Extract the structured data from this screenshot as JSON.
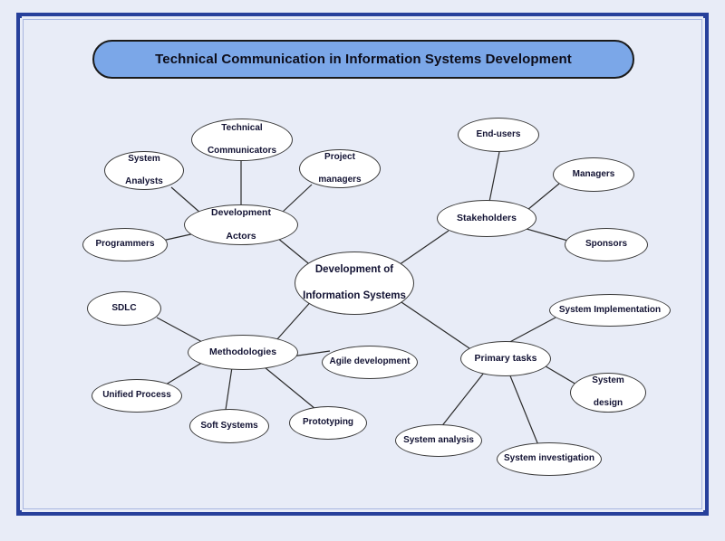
{
  "document": {
    "title": "Technical Communication in Information Systems Development",
    "background_color": "#e8ecf7",
    "frame_color": "#27409b",
    "title_fill_color": "#7ba7e8",
    "node_fill_color": "#ffffff",
    "node_text_color": "#121233"
  },
  "chart_data": {
    "type": "diagram",
    "diagram_kind": "mind-map",
    "title": "Technical Communication in Information Systems Development",
    "center": "Development of Information Systems",
    "branches": [
      {
        "label": "Development Actors",
        "children": [
          "Technical Communicators",
          "System Analysts",
          "Project managers",
          "Programmers"
        ]
      },
      {
        "label": "Stakeholders",
        "children": [
          "End-users",
          "Managers",
          "Sponsors"
        ]
      },
      {
        "label": "Methodologies",
        "children": [
          "SDLC",
          "Unified Process",
          "Soft Systems",
          "Prototyping",
          "Agile development"
        ]
      },
      {
        "label": "Primary tasks",
        "children": [
          "System Implementation",
          "System design",
          "System analysis",
          "System investigation"
        ]
      }
    ]
  },
  "nodes": {
    "center": {
      "line1": "Development of",
      "line2": "Information Systems"
    },
    "development_actors": {
      "line1": "Development",
      "line2": "Actors"
    },
    "technical_communicators": {
      "line1": "Technical",
      "line2": "Communicators"
    },
    "system_analysts": {
      "line1": "System",
      "line2": "Analysts"
    },
    "project_managers": {
      "line1": "Project",
      "line2": "managers"
    },
    "programmers": {
      "label": "Programmers"
    },
    "stakeholders": {
      "label": "Stakeholders"
    },
    "end_users": {
      "label": "End-users"
    },
    "managers": {
      "label": "Managers"
    },
    "sponsors": {
      "label": "Sponsors"
    },
    "methodologies": {
      "label": "Methodologies"
    },
    "sdlc": {
      "label": "SDLC"
    },
    "unified_process": {
      "label": "Unified Process"
    },
    "soft_systems": {
      "label": "Soft Systems"
    },
    "prototyping": {
      "label": "Prototyping"
    },
    "agile_development": {
      "label": "Agile development"
    },
    "primary_tasks": {
      "label": "Primary tasks"
    },
    "system_implementation": {
      "label": "System Implementation"
    },
    "system_design": {
      "line1": "System",
      "line2": "design"
    },
    "system_analysis": {
      "label": "System analysis"
    },
    "system_investigation": {
      "label": "System investigation"
    }
  }
}
